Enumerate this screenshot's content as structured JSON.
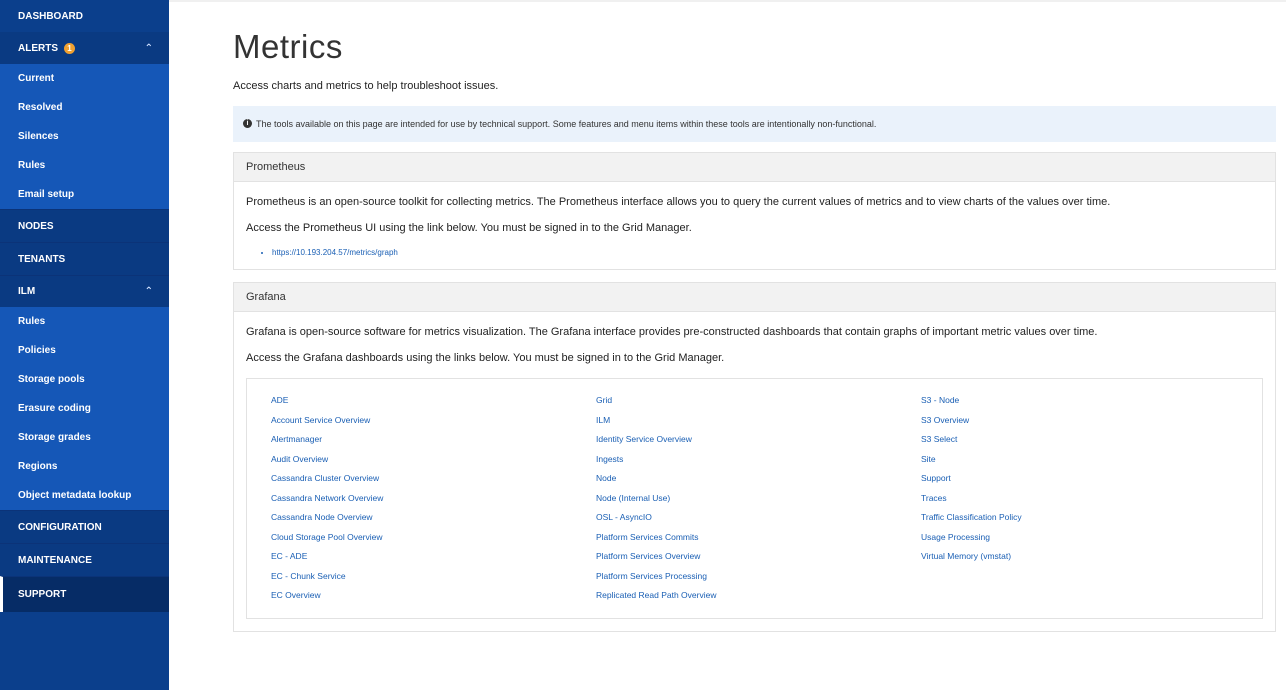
{
  "sidebar": {
    "dashboard": "DASHBOARD",
    "alerts": {
      "label": "ALERTS",
      "badge": "1",
      "items": [
        "Current",
        "Resolved",
        "Silences",
        "Rules",
        "Email setup"
      ]
    },
    "nodes": "NODES",
    "tenants": "TENANTS",
    "ilm": {
      "label": "ILM",
      "items": [
        "Rules",
        "Policies",
        "Storage pools",
        "Erasure coding",
        "Storage grades",
        "Regions",
        "Object metadata lookup"
      ]
    },
    "configuration": "CONFIGURATION",
    "maintenance": "MAINTENANCE",
    "support": "SUPPORT"
  },
  "page": {
    "title": "Metrics",
    "subtitle": "Access charts and metrics to help troubleshoot issues.",
    "info": "The tools available on this page are intended for use by technical support. Some features and menu items within these tools are intentionally non-functional."
  },
  "prometheus": {
    "heading": "Prometheus",
    "desc": "Prometheus is an open-source toolkit for collecting metrics. The Prometheus interface allows you to query the current values of metrics and to view charts of the values over time.",
    "access": "Access the Prometheus UI using the link below. You must be signed in to the Grid Manager.",
    "link": "https://10.193.204.57/metrics/graph"
  },
  "grafana": {
    "heading": "Grafana",
    "desc": "Grafana is open-source software for metrics visualization. The Grafana interface provides pre-constructed dashboards that contain graphs of important metric values over time.",
    "access": "Access the Grafana dashboards using the links below. You must be signed in to the Grid Manager.",
    "col1": [
      "ADE",
      "Account Service Overview",
      "Alertmanager",
      "Audit Overview",
      "Cassandra Cluster Overview",
      "Cassandra Network Overview",
      "Cassandra Node Overview",
      "Cloud Storage Pool Overview",
      "EC - ADE",
      "EC - Chunk Service",
      "EC Overview"
    ],
    "col2": [
      "Grid",
      "ILM",
      "Identity Service Overview",
      "Ingests",
      "Node",
      "Node (Internal Use)",
      "OSL - AsyncIO",
      "Platform Services Commits",
      "Platform Services Overview",
      "Platform Services Processing",
      "Replicated Read Path Overview"
    ],
    "col3": [
      "S3 - Node",
      "S3 Overview",
      "S3 Select",
      "Site",
      "Support",
      "Traces",
      "Traffic Classification Policy",
      "Usage Processing",
      "Virtual Memory (vmstat)"
    ]
  }
}
